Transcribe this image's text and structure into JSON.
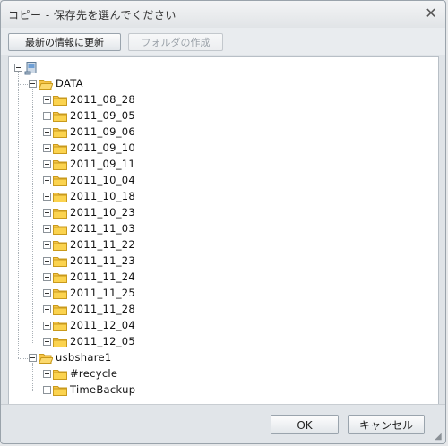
{
  "dialog": {
    "title": "コピー - 保存先を選んでください",
    "close_icon": "close-icon"
  },
  "toolbar": {
    "refresh_label": "最新の情報に更新",
    "new_folder_label": "フォルダの作成"
  },
  "tree": {
    "root_icon": "computer-icon",
    "shares": [
      {
        "name": "DATA",
        "expanded": true,
        "children": [
          "2011_08_28",
          "2011_09_05",
          "2011_09_06",
          "2011_09_10",
          "2011_09_11",
          "2011_10_04",
          "2011_10_18",
          "2011_10_23",
          "2011_11_03",
          "2011_11_22",
          "2011_11_23",
          "2011_11_24",
          "2011_11_25",
          "2011_11_28",
          "2011_12_04",
          "2011_12_05"
        ]
      },
      {
        "name": "usbshare1",
        "expanded": true,
        "children": [
          "#recycle",
          "TimeBackup"
        ]
      }
    ]
  },
  "footer": {
    "ok_label": "OK",
    "cancel_label": "キャンセル"
  },
  "colors": {
    "folder_fill": "#f7c548",
    "folder_edge": "#c99a1c"
  }
}
